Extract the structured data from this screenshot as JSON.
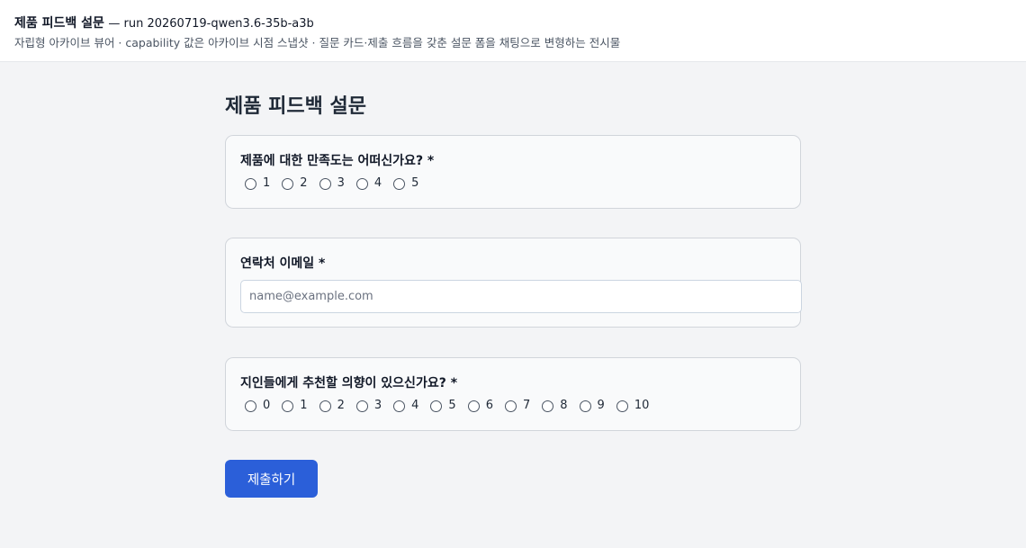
{
  "header": {
    "title": "제품 피드백 설문",
    "run_label": "— run 20260719-qwen3.6-35b-a3b",
    "subtitle": "자립형 아카이브 뷰어 · capability 값은 아카이브 시점 스냅샷 · 질문 카드·제출 흐름을 갖춘 설문 폼을 채팅으로 변형하는 전시물"
  },
  "form": {
    "title": "제품 피드백 설문",
    "questions": [
      {
        "label": "제품에 대한 만족도는 어떠신가요? *",
        "type": "radio",
        "options": [
          "1",
          "2",
          "3",
          "4",
          "5"
        ]
      },
      {
        "label": "연락처 이메일 *",
        "type": "email",
        "value": "",
        "placeholder": "name@example.com"
      },
      {
        "label": "지인들에게 추천할 의향이 있으신가요? *",
        "type": "radio",
        "options": [
          "0",
          "1",
          "2",
          "3",
          "4",
          "5",
          "6",
          "7",
          "8",
          "9",
          "10"
        ]
      }
    ],
    "submit_label": "제출하기"
  },
  "colors": {
    "accent": "#2b5fd9",
    "page_bg": "#f3f4f6",
    "card_bg": "#f9fafb"
  }
}
